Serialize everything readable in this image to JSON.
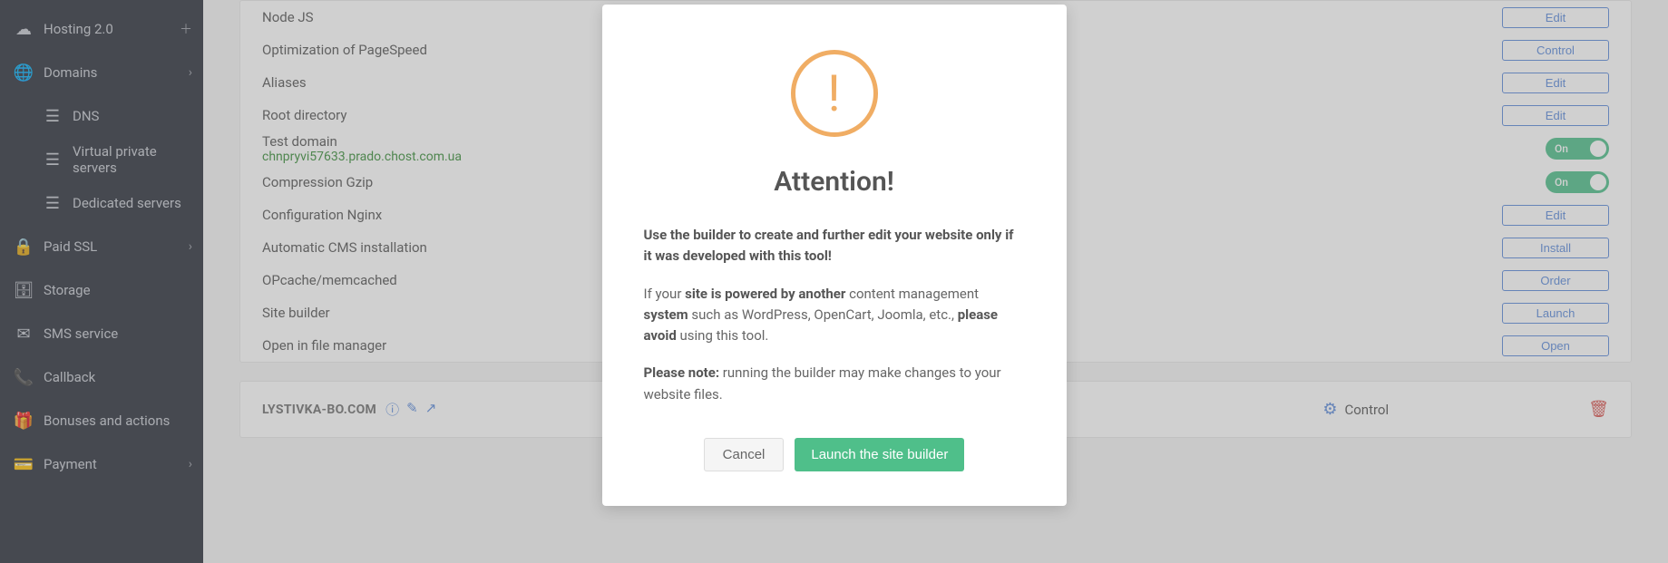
{
  "sidebar": {
    "items": [
      {
        "icon": "cloud",
        "label": "Hosting 2.0",
        "right": "plus"
      },
      {
        "icon": "globe",
        "label": "Domains",
        "right": "chevron"
      },
      {
        "icon": "dns",
        "label": "DNS",
        "sub": true
      },
      {
        "icon": "vps",
        "label": "Virtual private servers",
        "sub": true
      },
      {
        "icon": "dedicated",
        "label": "Dedicated servers",
        "sub": true
      },
      {
        "icon": "lock",
        "label": "Paid SSL",
        "right": "chevron"
      },
      {
        "icon": "archive",
        "label": "Storage"
      },
      {
        "icon": "mail",
        "label": "SMS service"
      },
      {
        "icon": "phone",
        "label": "Callback"
      },
      {
        "icon": "gift",
        "label": "Bonuses and actions"
      },
      {
        "icon": "card",
        "label": "Payment",
        "right": "chevron"
      }
    ]
  },
  "settings": {
    "rows": [
      {
        "label": "Node JS",
        "action": "btn",
        "action_label": "Edit"
      },
      {
        "label": "Optimization of PageSpeed",
        "action": "btn",
        "action_label": "Control"
      },
      {
        "label": "Aliases",
        "action": "btn",
        "action_label": "Edit"
      },
      {
        "label": "Root directory",
        "action": "btn",
        "action_label": "Edit"
      },
      {
        "label": "Test domain",
        "sublink": "chnpryvi57633.prado.chost.com.ua",
        "action": "toggle",
        "action_label": "On"
      },
      {
        "label": "Compression Gzip",
        "action": "toggle",
        "action_label": "On"
      },
      {
        "label": "Configuration Nginx",
        "action": "btn",
        "action_label": "Edit"
      },
      {
        "label": "Automatic CMS installation",
        "action": "btn",
        "action_label": "Install"
      },
      {
        "label": "OPcache/memcached",
        "action": "btn",
        "action_label": "Order"
      },
      {
        "label": "Site builder",
        "action": "btn",
        "action_label": "Launch"
      },
      {
        "label": "Open in file manager",
        "action": "btn",
        "action_label": "Open"
      }
    ]
  },
  "domain": {
    "name": "LYSTIVKA-BO.COM",
    "control_label": "Control"
  },
  "modal": {
    "title": "Attention!",
    "p1_bold": "Use the builder to create and further edit your website only if it was developed with this tool!",
    "p2_a": "If your ",
    "p2_b_bold": "site is powered by another",
    "p2_c": " content management ",
    "p2_d_bold": "system",
    "p2_e": " such as WordPress, OpenCart, Joomla, etc., ",
    "p2_f_bold": "please avoid",
    "p2_g": " using this tool.",
    "p3_a_bold": "Please note:",
    "p3_b": " running the builder may make changes to your website files.",
    "cancel": "Cancel",
    "launch": "Launch the site builder"
  },
  "icons": {
    "cloud": "☁",
    "globe": "🌐",
    "dns": "☰",
    "vps": "☰",
    "dedicated": "☰",
    "lock": "🔒",
    "archive": "🗄",
    "mail": "✉",
    "phone": "📞",
    "gift": "🎁",
    "card": "💳"
  }
}
